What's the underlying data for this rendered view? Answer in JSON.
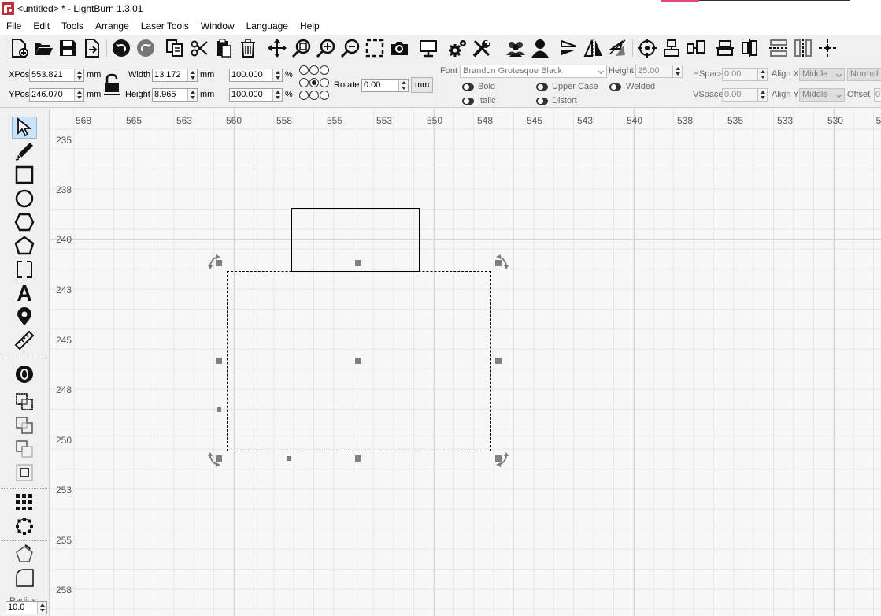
{
  "window": {
    "title": "<untitled> * - LightBurn 1.3.01"
  },
  "menu": [
    "File",
    "Edit",
    "Tools",
    "Arrange",
    "Laser Tools",
    "Window",
    "Language",
    "Help"
  ],
  "toolbar": {
    "buttons": [
      "new-file",
      "open-file",
      "save",
      "import",
      "undo",
      "redo",
      "copy",
      "cut",
      "paste",
      "delete",
      "move",
      "zoom-to-page",
      "zoom-in",
      "zoom-out",
      "frame-selection",
      "camera",
      "device-settings",
      "settings",
      "machine-settings",
      "group",
      "ungroup",
      "mirror-horizontal",
      "mirror-vertical",
      "mirror-across-line",
      "target",
      "align-top",
      "align-middle",
      "align-bottom",
      "align-left",
      "align-center",
      "distribute-horizontal",
      "distribute-vertical",
      "center-crosshair"
    ]
  },
  "props": {
    "xpos_label": "XPos",
    "xpos_value": "553.821",
    "ypos_label": "YPos",
    "ypos_value": "246.070",
    "unit_mm": "mm",
    "width_label": "Width",
    "width_value": "13.172",
    "height_label": "Height",
    "height_value": "8.965",
    "scale_x": "100.000",
    "scale_y": "100.000",
    "percent": "%",
    "rotate_label": "Rotate",
    "rotate_value": "0.00",
    "rotate_unit_button": "mm",
    "font_label": "Font",
    "font_value": "Brandon Grotesque Black",
    "text_height_label": "Height",
    "text_height_value": "25.00",
    "hspace_label": "HSpace",
    "hspace_value": "0.00",
    "vspace_label": "VSpace",
    "vspace_value": "0.00",
    "alignx_label": "Align X",
    "alignx_value": "Middle",
    "aligny_label": "Align Y",
    "aligny_value": "Middle",
    "mode_value": "Normal",
    "offset_label": "Offset",
    "offset_value": "0",
    "bold_label": "Bold",
    "italic_label": "Italic",
    "uppercase_label": "Upper Case",
    "distort_label": "Distort",
    "welded_label": "Welded"
  },
  "lefttools": {
    "radius_label": "Radius:",
    "radius_value": "10.0"
  },
  "ruler": {
    "x_ticks": [
      "568",
      "565",
      "563",
      "560",
      "558",
      "555",
      "553",
      "550",
      "548",
      "545",
      "543",
      "540",
      "538",
      "535",
      "533",
      "530",
      "5"
    ],
    "y_ticks": [
      "235",
      "238",
      "240",
      "243",
      "245",
      "248",
      "250",
      "253",
      "255",
      "258"
    ]
  },
  "colors": {
    "background": "#f0f0f0",
    "canvas": "#f7f7f7",
    "handle": "#808080",
    "selection_tool_highlight": "#cde3f7"
  }
}
